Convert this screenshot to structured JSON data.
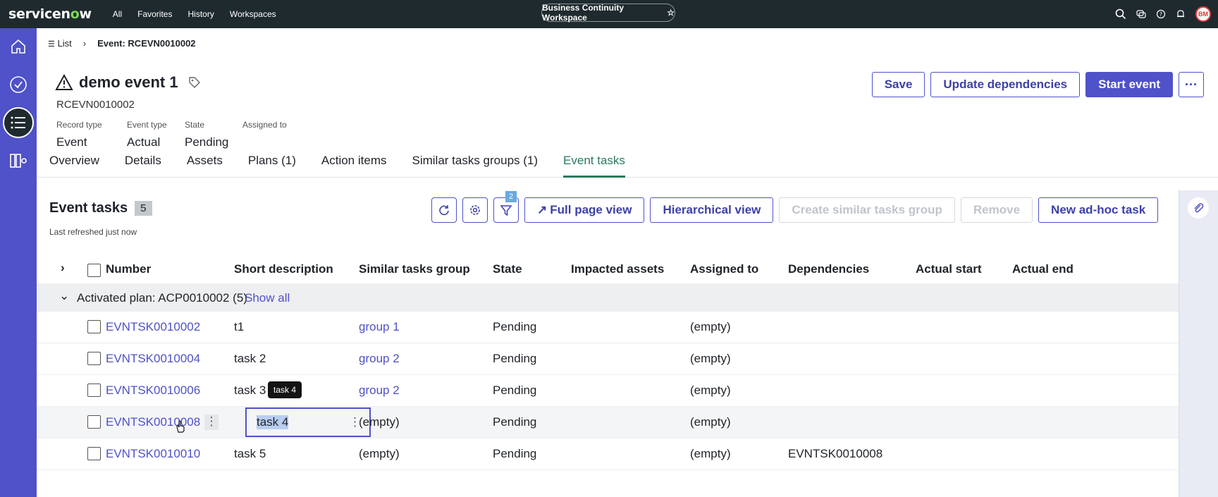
{
  "topbar": {
    "logo": "servicenow",
    "nav": [
      "All",
      "Favorites",
      "History",
      "Workspaces"
    ],
    "workspace": "Business Continuity Workspace",
    "avatar": "BM"
  },
  "breadcrumb": {
    "list": "List",
    "current": "Event: RCEVN0010002"
  },
  "record": {
    "title": "demo event 1",
    "number": "RCEVN0010002",
    "fields": [
      {
        "label": "Record type",
        "value": "Event"
      },
      {
        "label": "Event type",
        "value": "Actual"
      },
      {
        "label": "State",
        "value": "Pending"
      },
      {
        "label": "Assigned to",
        "value": ""
      }
    ]
  },
  "header_buttons": {
    "save": "Save",
    "update": "Update dependencies",
    "start": "Start event"
  },
  "tabs": [
    "Overview",
    "Details",
    "Assets",
    "Plans (1)",
    "Action items",
    "Similar tasks groups (1)",
    "Event tasks"
  ],
  "panel": {
    "title": "Event tasks",
    "count": "5",
    "refreshed": "Last refreshed just now",
    "filter_count": "2",
    "buttons": {
      "full_page": "Full page view",
      "hierarchical": "Hierarchical view",
      "create_group": "Create similar tasks group",
      "remove": "Remove",
      "new_task": "New ad-hoc task"
    },
    "columns": [
      "Number",
      "Short description",
      "Similar tasks group",
      "State",
      "Impacted assets",
      "Assigned to",
      "Dependencies",
      "Actual start",
      "Actual end"
    ],
    "group": {
      "label": "Activated plan: ACP0010002 (5)",
      "show_all": "Show all"
    },
    "rows": [
      {
        "number": "EVNTSK0010002",
        "desc": "t1",
        "group": "group 1",
        "state": "Pending",
        "assigned": "(empty)",
        "deps": ""
      },
      {
        "number": "EVNTSK0010004",
        "desc": "task 2",
        "group": "group 2",
        "state": "Pending",
        "assigned": "(empty)",
        "deps": ""
      },
      {
        "number": "EVNTSK0010006",
        "desc": "task 3",
        "group": "group 2",
        "state": "Pending",
        "assigned": "(empty)",
        "deps": ""
      },
      {
        "number": "EVNTSK0010008",
        "desc": "task 4",
        "group": "(empty)",
        "state": "Pending",
        "assigned": "(empty)",
        "deps": ""
      },
      {
        "number": "EVNTSK0010010",
        "desc": "task 5",
        "group": "(empty)",
        "state": "Pending",
        "assigned": "(empty)",
        "deps": "EVNTSK0010008"
      }
    ],
    "tooltip": "task 4"
  },
  "colors": {
    "accent": "#4f52c8",
    "nav_dark": "#1f2a2e",
    "active_tab": "#2a7a5a",
    "logo_green": "#7ed957"
  }
}
